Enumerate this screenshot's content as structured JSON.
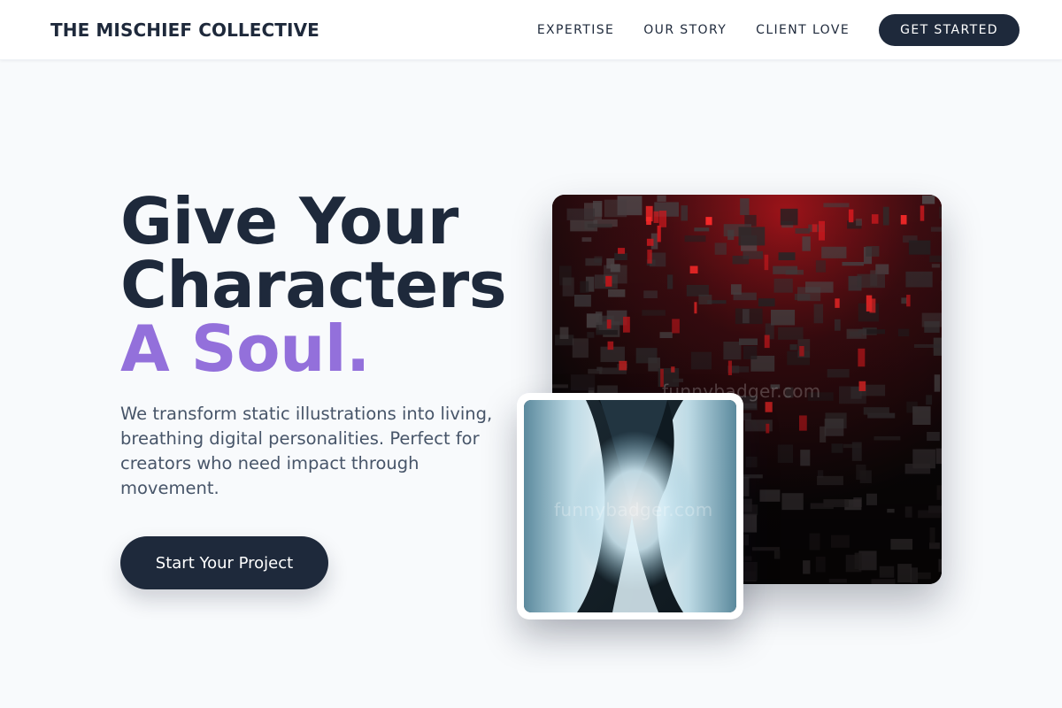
{
  "header": {
    "brand": "THE MISCHIEF COLLECTIVE",
    "nav": [
      "EXPERTISE",
      "OUR STORY",
      "CLIENT LOVE"
    ],
    "cta_label": "GET STARTED"
  },
  "hero": {
    "headline_line1": "Give Your",
    "headline_line2": "Characters",
    "headline_accent": "A Soul.",
    "description": "We transform static illustrations into living, breathing digital personalities. Perfect for creators who need impact through movement.",
    "cta_label": "Start Your Project"
  },
  "images": {
    "main_watermark": "funnybadger.com",
    "small_watermark": "funnybadger.com"
  },
  "colors": {
    "primary": "#1e293b",
    "accent": "#9370db",
    "background": "#f8fafc"
  }
}
